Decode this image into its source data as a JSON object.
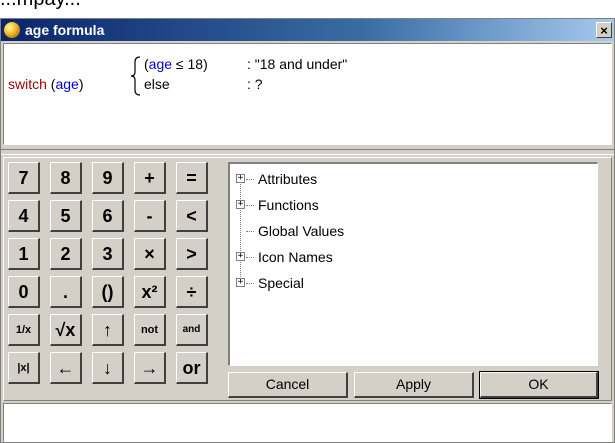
{
  "background_text": "...mpay...",
  "window": {
    "title": "age formula",
    "close_label": "×"
  },
  "formula": {
    "switch_kw": "switch",
    "open_paren": "(",
    "switch_var": "age",
    "close_paren": ")",
    "case1_open": "(",
    "case1_var": "age",
    "case1_op": " ≤ 18",
    "case1_close": ")",
    "case1_result": ": \"18 and under\"",
    "case2_label": "else",
    "case2_result": ": ?"
  },
  "keypad": {
    "rows": [
      [
        "7",
        "8",
        "9",
        "+",
        "="
      ],
      [
        "4",
        "5",
        "6",
        "-",
        "<"
      ],
      [
        "1",
        "2",
        "3",
        "×",
        ">"
      ],
      [
        "0",
        ".",
        "()",
        "x²",
        "÷"
      ],
      [
        "1/x",
        "√x",
        "↑",
        "not",
        "and"
      ],
      [
        "|x|",
        "←",
        "↓",
        "→",
        "or"
      ]
    ]
  },
  "tree": {
    "items": [
      {
        "label": "Attributes",
        "expandable": true
      },
      {
        "label": "Functions",
        "expandable": true
      },
      {
        "label": "Global Values",
        "expandable": false
      },
      {
        "label": "Icon Names",
        "expandable": true
      },
      {
        "label": "Special",
        "expandable": true
      }
    ]
  },
  "buttons": {
    "cancel": "Cancel",
    "apply": "Apply",
    "ok": "OK"
  },
  "colors": {
    "keyword": "#990000",
    "variable": "#0000cc",
    "titlebar_start": "#0a246a",
    "face": "#d4d0c8"
  }
}
